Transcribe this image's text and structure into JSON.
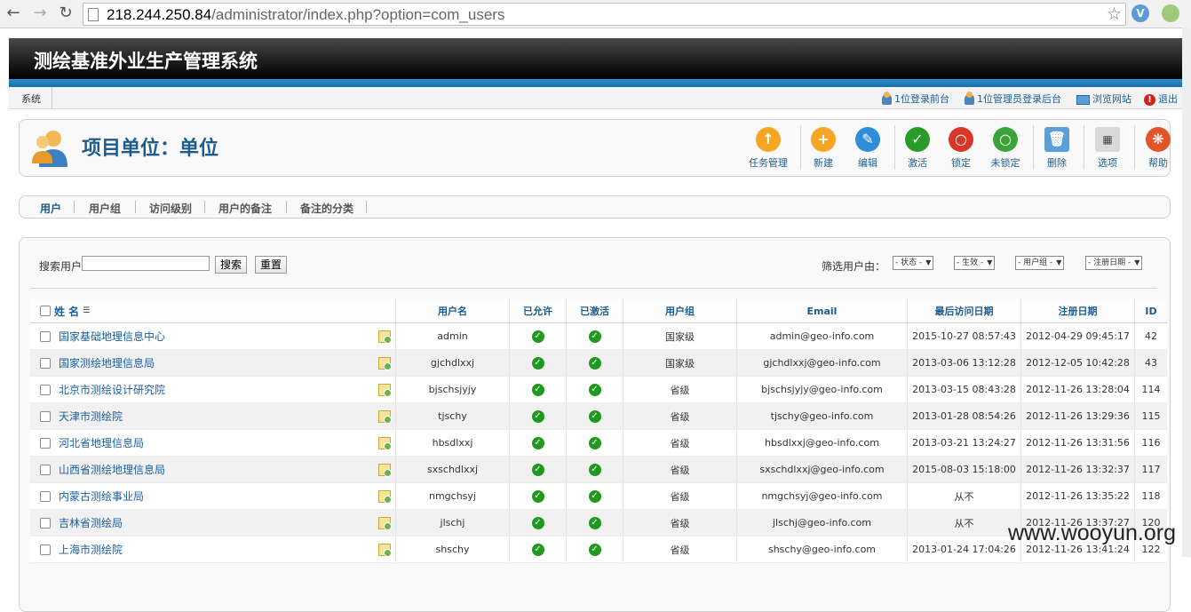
{
  "browser": {
    "url_host": "218.244.250.84",
    "url_path": "/administrator/index.php?option=com_users"
  },
  "app": {
    "title": "测绘基准外业生产管理系统",
    "menu_system": "系统",
    "status_links": [
      "1位登录前台",
      "1位管理员登录后台",
      "浏览网站",
      "退出"
    ]
  },
  "page": {
    "title": "项目单位：单位"
  },
  "toolbar": {
    "buttons": [
      "任务管理",
      "新建",
      "编辑",
      "激活",
      "锁定",
      "未锁定",
      "删除",
      "选项",
      "帮助"
    ]
  },
  "tabs": [
    "用户",
    "用户组",
    "访问级别",
    "用户的备注",
    "备注的分类"
  ],
  "search": {
    "label": "搜索用户",
    "value": "",
    "search_button": "搜索",
    "reset_button": "重置"
  },
  "filters": {
    "label": "筛选用户由：",
    "options": [
      "- 状态 -",
      "- 生效 -",
      "- 用户组 -",
      "- 注册日期 -"
    ]
  },
  "table": {
    "columns": [
      "姓 名",
      "用户名",
      "已允许",
      "已激活",
      "用户组",
      "Email",
      "最后访问日期",
      "注册日期",
      "ID"
    ],
    "rows": [
      {
        "name": "国家基础地理信息中心",
        "username": "admin",
        "group": "国家级",
        "email": "admin@geo-info.com",
        "last_visit": "2015-10-27 08:57:43",
        "registered": "2012-04-29 09:45:17",
        "id": "42"
      },
      {
        "name": "国家测绘地理信息局",
        "username": "gjchdlxxj",
        "group": "国家级",
        "email": "gjchdlxxj@geo-info.com",
        "last_visit": "2013-03-06 13:12:28",
        "registered": "2012-12-05 10:42:28",
        "id": "43"
      },
      {
        "name": "北京市测绘设计研究院",
        "username": "bjschsjyjy",
        "group": "省级",
        "email": "bjschsjyjy@geo-info.com",
        "last_visit": "2013-03-15 08:43:28",
        "registered": "2012-11-26 13:28:04",
        "id": "114"
      },
      {
        "name": "天津市测绘院",
        "username": "tjschy",
        "group": "省级",
        "email": "tjschy@geo-info.com",
        "last_visit": "2013-01-28 08:54:26",
        "registered": "2012-11-26 13:29:36",
        "id": "115"
      },
      {
        "name": "河北省地理信息局",
        "username": "hbsdlxxj",
        "group": "省级",
        "email": "hbsdlxxj@geo-info.com",
        "last_visit": "2013-03-21 13:24:27",
        "registered": "2012-11-26 13:31:56",
        "id": "116"
      },
      {
        "name": "山西省测绘地理信息局",
        "username": "sxschdlxxj",
        "group": "省级",
        "email": "sxschdlxxj@geo-info.com",
        "last_visit": "2015-08-03 15:18:00",
        "registered": "2012-11-26 13:32:37",
        "id": "117"
      },
      {
        "name": "内蒙古测绘事业局",
        "username": "nmgchsyj",
        "group": "省级",
        "email": "nmgchsyj@geo-info.com",
        "last_visit": "从不",
        "registered": "2012-11-26 13:35:22",
        "id": "118"
      },
      {
        "name": "吉林省测绘局",
        "username": "jlschj",
        "group": "省级",
        "email": "jlschj@geo-info.com",
        "last_visit": "从不",
        "registered": "2012-11-26 13:37:27",
        "id": "120"
      },
      {
        "name": "上海市测绘院",
        "username": "shschy",
        "group": "省级",
        "email": "shschy@geo-info.com",
        "last_visit": "2013-01-24 17:04:26",
        "registered": "2012-11-26 13:41:24",
        "id": "122"
      }
    ]
  },
  "watermark": "www.wooyun.org",
  "colors": {
    "accent_blue": "#1d5d8e",
    "link_blue": "#1a5fa0",
    "check_green": "#1f9a1f"
  }
}
